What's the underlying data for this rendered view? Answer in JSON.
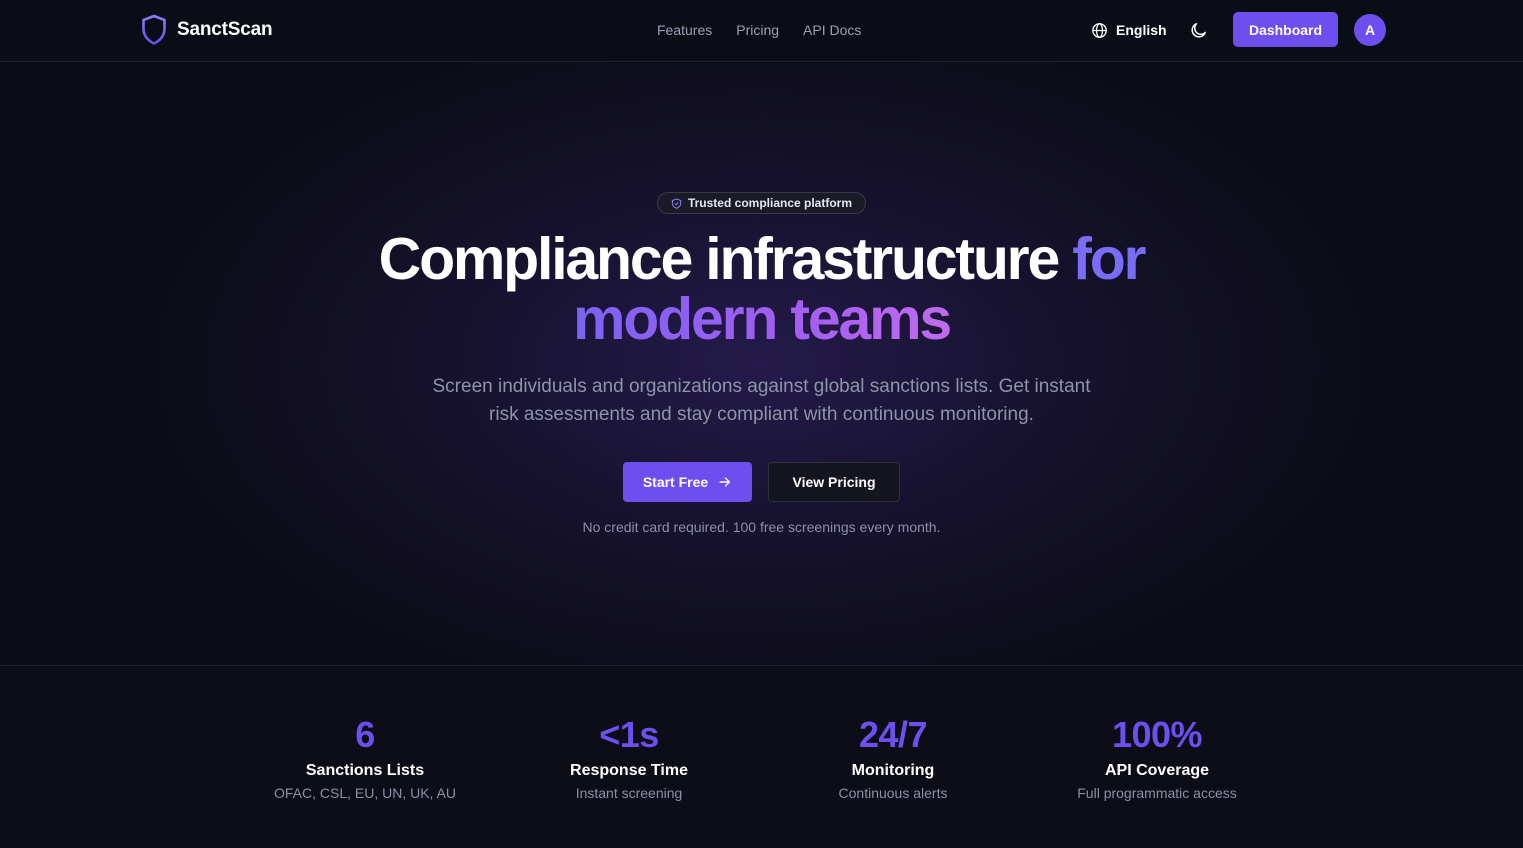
{
  "brand": {
    "name": "SanctScan",
    "icon": "shield-icon"
  },
  "nav": {
    "links": [
      "Features",
      "Pricing",
      "API Docs"
    ],
    "language": "English",
    "theme_icon": "moon-icon",
    "dashboard_label": "Dashboard",
    "avatar_initial": "A"
  },
  "hero": {
    "badge": "Trusted compliance platform",
    "headline_white": "Compliance infrastructure ",
    "headline_accent": "for",
    "headline_gradient": "modern teams",
    "subtext": "Screen individuals and organizations against global sanctions lists. Get instant risk assessments and stay compliant with continuous monitoring.",
    "start_label": "Start Free",
    "pricing_label": "View Pricing",
    "note": "No credit card required. 100 free screenings every month."
  },
  "stats": [
    {
      "value": "6",
      "label": "Sanctions Lists",
      "desc": "OFAC, CSL, EU, UN, UK, AU"
    },
    {
      "value": "<1s",
      "label": "Response Time",
      "desc": "Instant screening"
    },
    {
      "value": "24/7",
      "label": "Monitoring",
      "desc": "Continuous alerts"
    },
    {
      "value": "100%",
      "label": "API Coverage",
      "desc": "Full programmatic access"
    }
  ],
  "colors": {
    "accent": "#6d4ff0",
    "background": "#0a0b12"
  }
}
